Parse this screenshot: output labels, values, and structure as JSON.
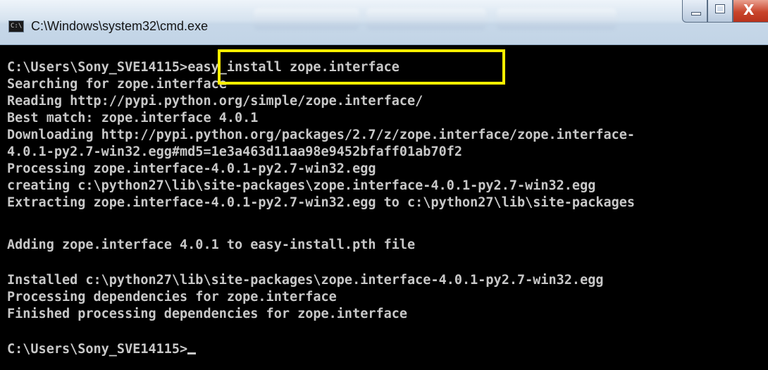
{
  "window": {
    "title": "C:\\Windows\\system32\\cmd.exe",
    "icon": "cmd-icon",
    "icon_glyph": "C:\\",
    "controls": {
      "minimize": "minimize-icon",
      "maximize": "maximize-icon",
      "close": "close-icon",
      "close_glyph": "X"
    }
  },
  "console": {
    "prompt_path": "C:\\Users\\Sony_SVE14115",
    "prompt_symbol": ">",
    "command": "easy_install zope.interface",
    "lines": [
      "Searching for zope.interface",
      "Reading http://pypi.python.org/simple/zope.interface/",
      "Best match: zope.interface 4.0.1",
      "Downloading http://pypi.python.org/packages/2.7/z/zope.interface/zope.interface-",
      "4.0.1-py2.7-win32.egg#md5=1e3a463d11aa98e9452bfaff01ab70f2",
      "Processing zope.interface-4.0.1-py2.7-win32.egg",
      "creating c:\\python27\\lib\\site-packages\\zope.interface-4.0.1-py2.7-win32.egg",
      "Extracting zope.interface-4.0.1-py2.7-win32.egg to c:\\python27\\lib\\site-packages",
      "",
      "Adding zope.interface 4.0.1 to easy-install.pth file",
      "",
      "Installed c:\\python27\\lib\\site-packages\\zope.interface-4.0.1-py2.7-win32.egg",
      "Processing dependencies for zope.interface",
      "Finished processing dependencies for zope.interface",
      ""
    ],
    "final_prompt": "C:\\Users\\Sony_SVE14115>"
  },
  "colors": {
    "console_background": "#000000",
    "console_text": "#c8c8c8",
    "highlight_border": "#ffef00",
    "titlebar": "#c6d7e8",
    "close_button": "#c9452c"
  }
}
